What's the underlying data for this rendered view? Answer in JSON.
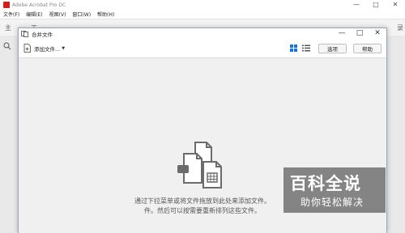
{
  "app": {
    "title": "Adobe Acrobat Pro DC",
    "menu": [
      "文件(F)",
      "编辑(E)",
      "视图(V)",
      "窗口(W)",
      "帮助(H)"
    ],
    "tabs": {
      "home": "主",
      "tools": "工",
      "search_partial": "录"
    },
    "window_controls": {
      "minimize": "—",
      "maximize": "□",
      "close": "✕"
    }
  },
  "dialog": {
    "title": "合并文件",
    "controls": {
      "minimize": "—",
      "maximize": "□",
      "close": "✕"
    },
    "toolbar": {
      "add_files_label": "添加文件...",
      "options_label": "选项",
      "help_label": "帮助"
    },
    "hint": {
      "line1": "通过下拉菜单或将文件拖放到此处来添加文件。",
      "line2": "件。然后可以按需要重新排列这些文件。"
    }
  },
  "watermark": {
    "title": "百科全说",
    "subtitle": "助你轻松解决"
  },
  "colors": {
    "accent": "#1473e6",
    "logo": "#d2211c",
    "body_bg": "#f0f0f0"
  }
}
